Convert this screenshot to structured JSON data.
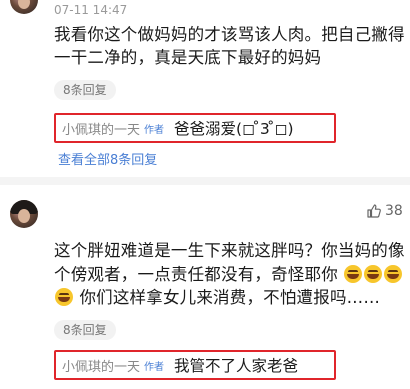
{
  "comment1": {
    "time": "07-11 14:47",
    "lines": [
      "我看你这个做妈妈的才该骂该人肉。把自己撇得",
      "一干二净的，真是天底下最好的妈妈"
    ],
    "replies_pill": "8条回复",
    "reply": {
      "user": "小佩琪的一天",
      "tag": "作者",
      "text": "爸爸溺爱(◻ ̊3 ̊◻)"
    },
    "view_all": "查看全部8条回复"
  },
  "comment2": {
    "like_count": "38",
    "line1": "这个胖妞难道是一生下来就这胖吗？你当妈的像",
    "line2": "个傍观者，一点责任都没有，奇怪耶你",
    "line3": "你们这样拿女儿来消费，不怕遭报吗……",
    "replies_pill": "8条回复",
    "reply": {
      "user": "小佩琪的一天",
      "tag": "作者",
      "text": "我管不了人家老爸"
    }
  },
  "icons": [
    "avatar",
    "thumb-up-icon",
    "laugh-cry-emoji-icon",
    "grin-emoji-icon"
  ],
  "colors": {
    "highlight_border": "#e0252b",
    "link": "#4a7fd4",
    "author_tag": "#4a7fd4"
  }
}
